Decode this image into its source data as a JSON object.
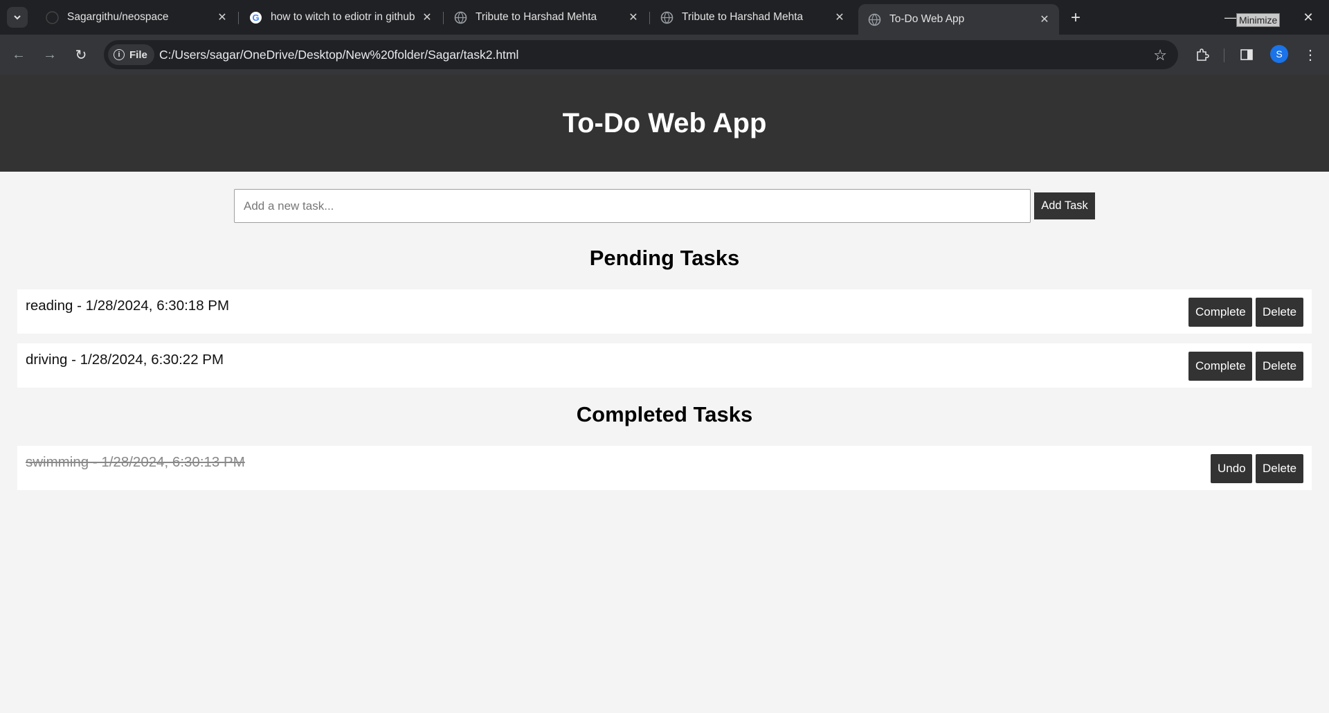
{
  "browser": {
    "tabs": [
      {
        "title": "Sagargithu/neospace",
        "icon": "github-icon"
      },
      {
        "title": "how to witch to ediotr in github",
        "icon": "google-icon"
      },
      {
        "title": "Tribute to Harshad Mehta",
        "icon": "globe-icon"
      },
      {
        "title": "Tribute to Harshad Mehta",
        "icon": "globe-icon"
      },
      {
        "title": "To-Do Web App",
        "icon": "globe-icon",
        "active": true
      }
    ],
    "tooltip": "Minimize",
    "address": {
      "chip_label": "File",
      "url": "C:/Users/sagar/OneDrive/Desktop/New%20folder/Sagar/task2.html"
    },
    "profile_initial": "S",
    "accent": "#1a73e8"
  },
  "app": {
    "title": "To-Do Web App",
    "input_placeholder": "Add a new task...",
    "add_button": "Add Task",
    "pending_heading": "Pending Tasks",
    "completed_heading": "Completed Tasks",
    "pending": [
      {
        "text": "reading - 1/28/2024, 6:30:18 PM",
        "complete_label": "Complete",
        "delete_label": "Delete"
      },
      {
        "text": "driving - 1/28/2024, 6:30:22 PM",
        "complete_label": "Complete",
        "delete_label": "Delete"
      }
    ],
    "completed": [
      {
        "text": "swimming - 1/28/2024, 6:30:13 PM",
        "undo_label": "Undo",
        "delete_label": "Delete"
      }
    ],
    "colors": {
      "header_bg": "#333333",
      "page_bg": "#f4f4f4",
      "button_bg": "#333333"
    }
  }
}
